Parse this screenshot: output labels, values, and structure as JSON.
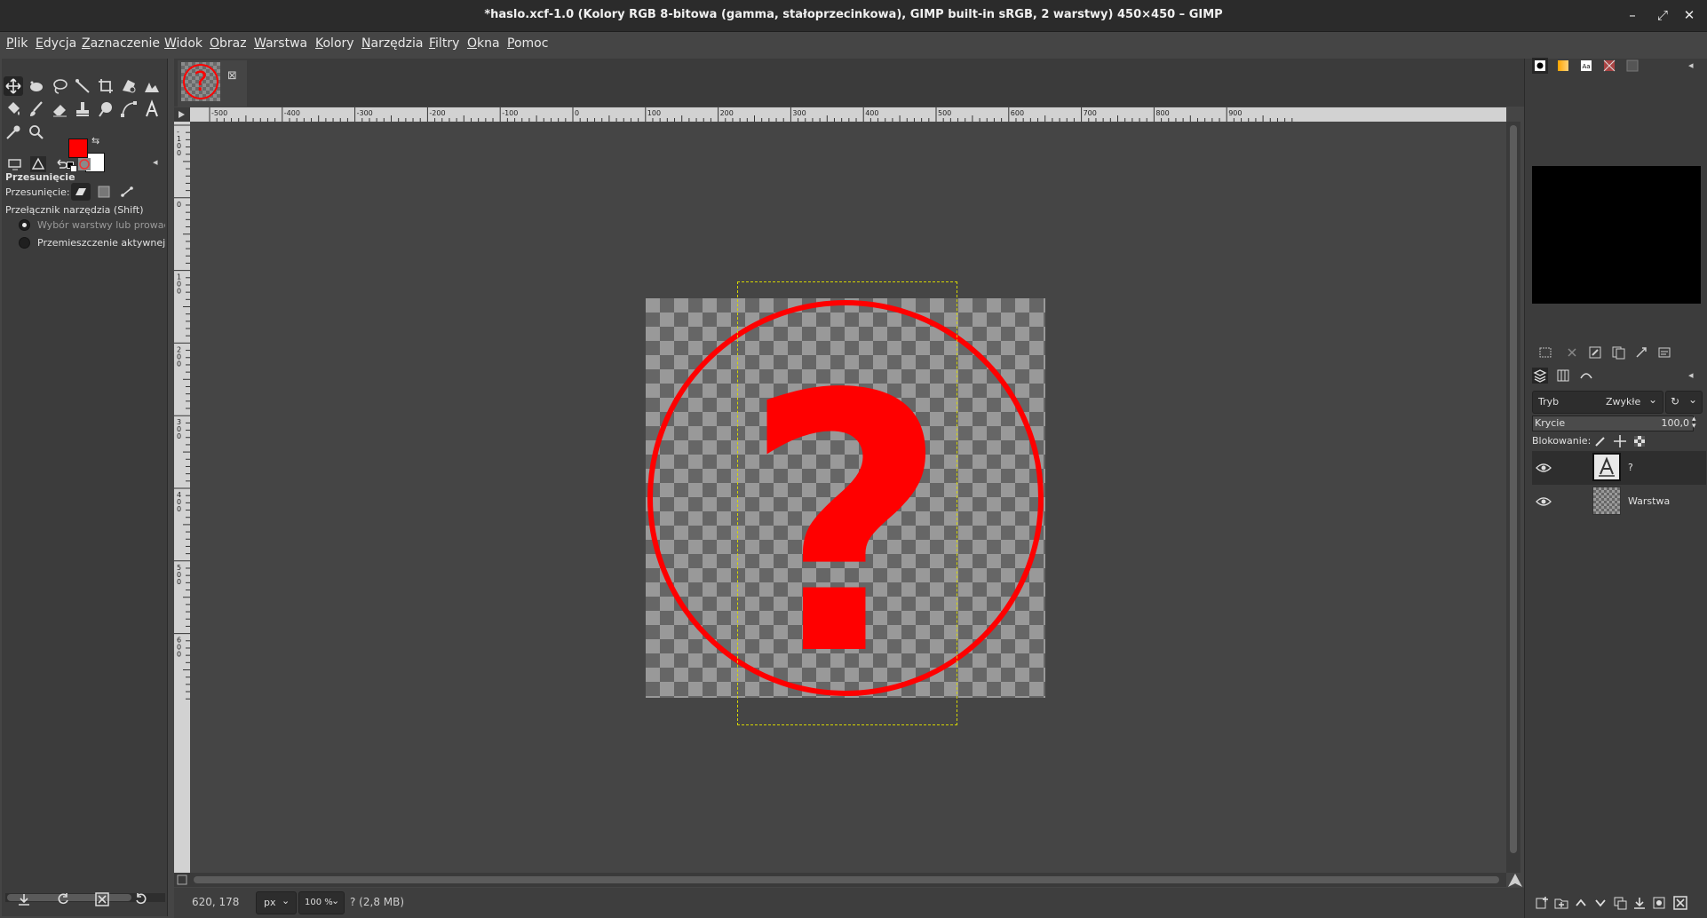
{
  "window": {
    "title": "*haslo.xcf-1.0 (Kolory RGB 8-bitowa (gamma, stałoprzecinkowa), GIMP built-in sRGB, 2 warstwy) 450×450 – GIMP",
    "minimize_glyph": "–",
    "restore_glyph": "⤢",
    "close_glyph": "✕"
  },
  "menu": [
    "Plik",
    "Edycja",
    "Zaznaczenie",
    "Widok",
    "Obraz",
    "Warstwa",
    "Kolory",
    "Narzędzia",
    "Filtry",
    "Okna",
    "Pomoc"
  ],
  "colors": {
    "foreground": "#ff0000",
    "background": "#ffffff",
    "accent": "#ff0000"
  },
  "tool_options": {
    "title": "Przesunięcie",
    "move_label": "Przesunięcie:",
    "toggle_label": "Przełącznik narzędzia  (Shift)",
    "option_pick": "Wybór warstwy lub prowadnicy",
    "option_active": "Przemieszczenie aktywnej"
  },
  "rulers": {
    "top": [
      "-500",
      "-400",
      "-300",
      "-200",
      "-100",
      "0",
      "100",
      "200",
      "300",
      "400",
      "500",
      "600",
      "700",
      "800",
      "900"
    ],
    "left": [
      "-100",
      "0",
      "100",
      "200",
      "300",
      "400",
      "500",
      "600"
    ]
  },
  "canvas": {
    "glyph": "?"
  },
  "status": {
    "coords": "620, 178",
    "unit": "px",
    "zoom": "100 %",
    "info": "? (2,8 MB)"
  },
  "layers_panel": {
    "mode_label": "Tryb",
    "mode_value": "Zwykłe",
    "opacity_label": "Krycie",
    "opacity_value": "100,0",
    "lock_label": "Blokowanie:",
    "layers": [
      {
        "name": "?",
        "type": "text"
      },
      {
        "name": "Warstwa",
        "type": "image"
      }
    ]
  }
}
